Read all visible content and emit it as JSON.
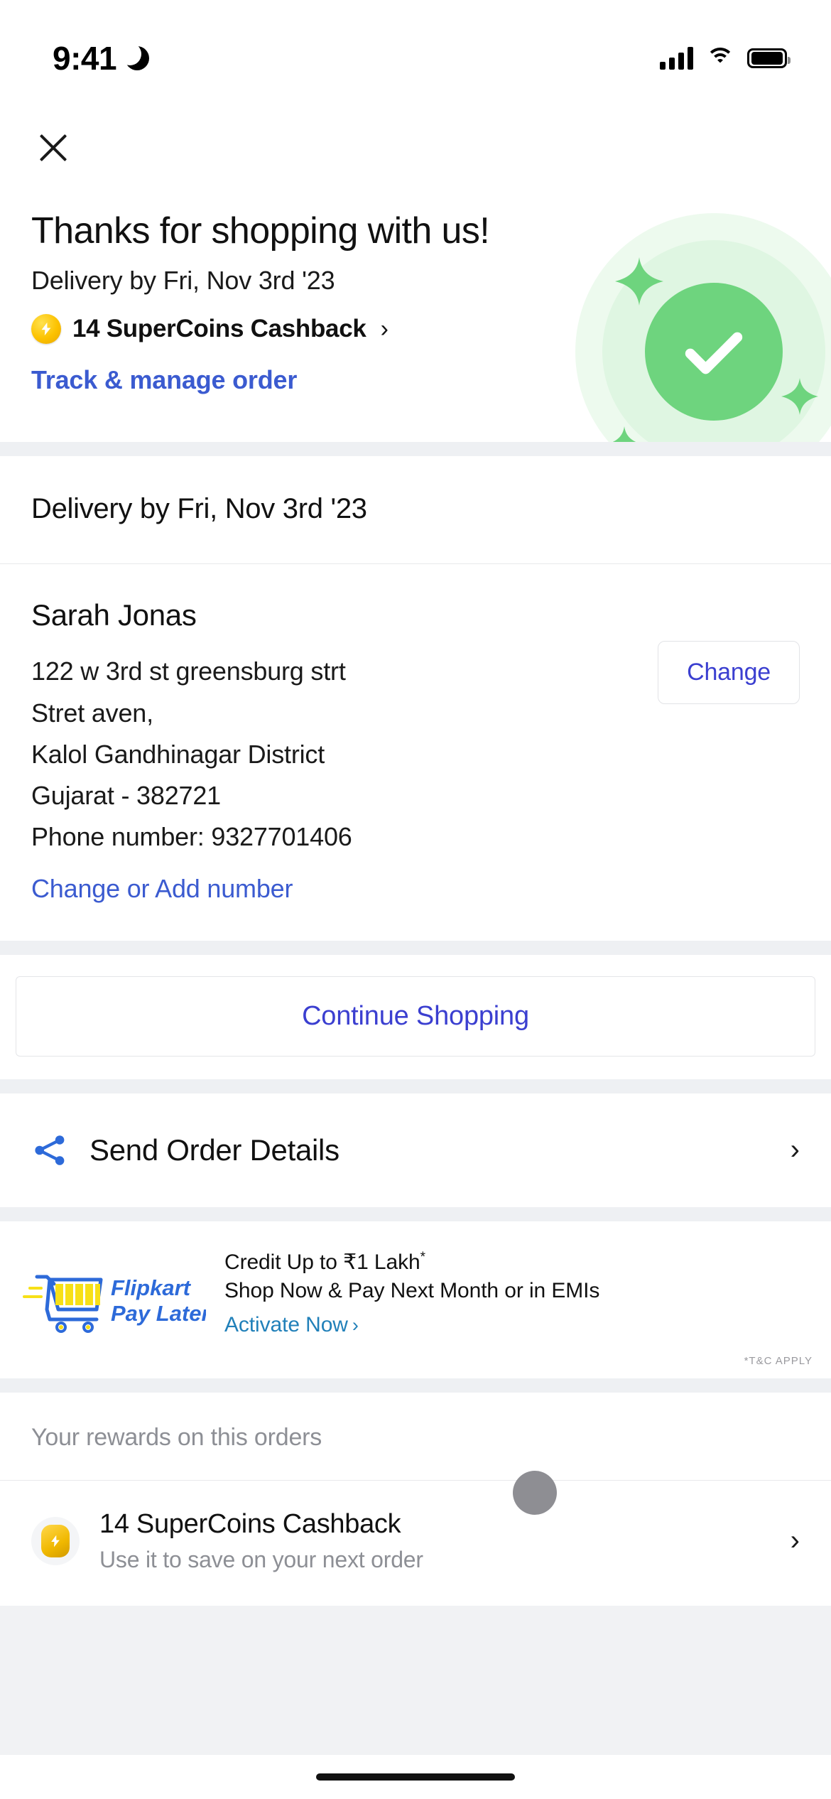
{
  "status_bar": {
    "time": "9:41",
    "dnd_icon": "crescent-moon-icon",
    "cellular_icon": "cellular-bars-icon",
    "wifi_icon": "wifi-icon",
    "battery_icon": "battery-full-icon"
  },
  "header": {
    "close_icon": "close-icon"
  },
  "hero": {
    "title": "Thanks for shopping with us!",
    "delivery_text": "Delivery by Fri, Nov 3rd '23",
    "supercoins_label": "14 SuperCoins Cashback",
    "supercoins_chevron": "›",
    "supercoins_icon": "supercoin-bolt-icon",
    "track_link": "Track & manage order",
    "success_icon": "success-check-icon",
    "success_color": "#6ed47e"
  },
  "delivery_band": {
    "text": "Delivery by Fri, Nov 3rd '23"
  },
  "address": {
    "name": "Sarah Jonas",
    "line1": "122 w 3rd st greensburg strt",
    "line2": "Stret aven,",
    "line3": "Kalol Gandhinagar District",
    "line4": "Gujarat - 382721",
    "phone": "Phone number: 9327701406",
    "change_number_link": "Change or Add number",
    "change_button": "Change"
  },
  "continue": {
    "label": "Continue Shopping"
  },
  "send_order": {
    "label": "Send Order Details",
    "share_icon": "share-icon",
    "chevron": "›"
  },
  "pay_later": {
    "logo_icon": "flipkart-pay-later-logo",
    "logo_line1": "Flipkart",
    "logo_line2": "Pay Later",
    "headline": "Credit Up to ₹1 Lakh",
    "headline_sup": "*",
    "subline": "Shop Now & Pay Next Month or in EMIs",
    "cta": "Activate Now",
    "cta_chevron": "›",
    "cta_color": "#2180b9",
    "terms": "*T&C APPLY"
  },
  "rewards": {
    "section_title": "Your rewards on this orders",
    "item_icon": "supercoin-bolt-icon",
    "item_title": "14 SuperCoins Cashback",
    "item_subtitle": "Use it to save on your next order",
    "chevron": "›"
  },
  "system": {
    "home_indicator": "home-indicator"
  }
}
